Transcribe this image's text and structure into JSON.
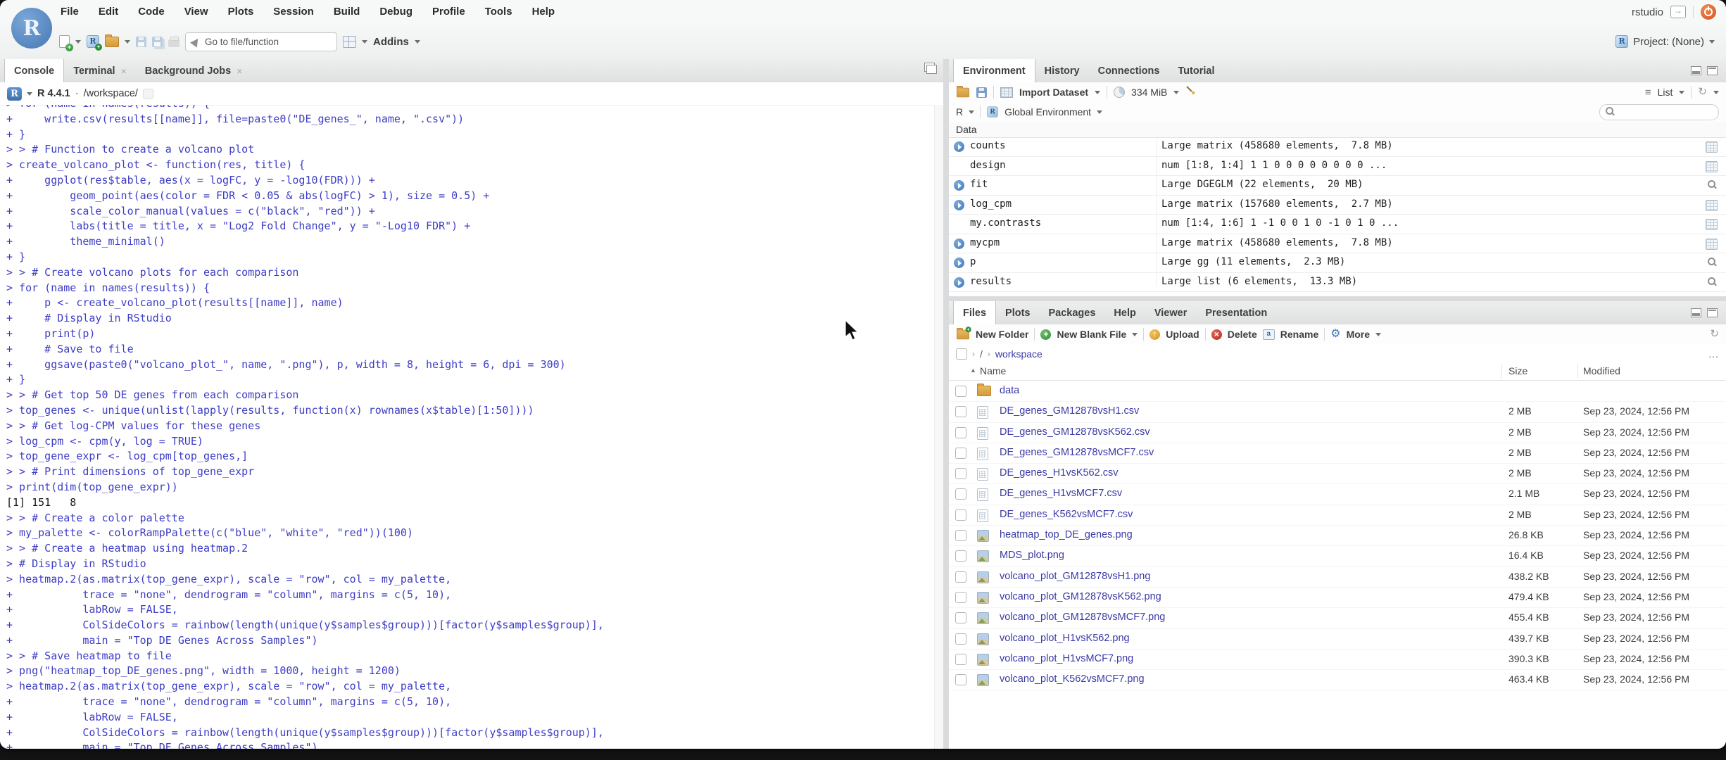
{
  "window": {
    "logo_letter": "R",
    "user": "rstudio",
    "project_label": "Project: (None)"
  },
  "menubar": {
    "items": [
      "File",
      "Edit",
      "Code",
      "View",
      "Plots",
      "Session",
      "Build",
      "Debug",
      "Profile",
      "Tools",
      "Help"
    ]
  },
  "toolbar": {
    "goto_placeholder": "Go to file/function",
    "addins_label": "Addins"
  },
  "console": {
    "tabs": [
      "Console",
      "Terminal",
      "Background Jobs"
    ],
    "r_version": "R 4.4.1",
    "separator": "·",
    "working_dir": "/workspace/",
    "lines": [
      {
        "text": "> for (name in names(results)) {",
        "kind": "input"
      },
      {
        "text": "+     write.csv(results[[name]], file=paste0(\"DE_genes_\", name, \".csv\"))",
        "kind": "input"
      },
      {
        "text": "+ }",
        "kind": "input"
      },
      {
        "text": "> > # Function to create a volcano plot",
        "kind": "input"
      },
      {
        "text": "> create_volcano_plot <- function(res, title) {",
        "kind": "input"
      },
      {
        "text": "+     ggplot(res$table, aes(x = logFC, y = -log10(FDR))) +",
        "kind": "input"
      },
      {
        "text": "+         geom_point(aes(color = FDR < 0.05 & abs(logFC) > 1), size = 0.5) +",
        "kind": "input"
      },
      {
        "text": "+         scale_color_manual(values = c(\"black\", \"red\")) +",
        "kind": "input"
      },
      {
        "text": "+         labs(title = title, x = \"Log2 Fold Change\", y = \"-Log10 FDR\") +",
        "kind": "input"
      },
      {
        "text": "+         theme_minimal()",
        "kind": "input"
      },
      {
        "text": "+ }",
        "kind": "input"
      },
      {
        "text": "> > # Create volcano plots for each comparison",
        "kind": "input"
      },
      {
        "text": "> for (name in names(results)) {",
        "kind": "input"
      },
      {
        "text": "+     p <- create_volcano_plot(results[[name]], name)",
        "kind": "input"
      },
      {
        "text": "+     # Display in RStudio",
        "kind": "input"
      },
      {
        "text": "+     print(p)",
        "kind": "input"
      },
      {
        "text": "+     # Save to file",
        "kind": "input"
      },
      {
        "text": "+     ggsave(paste0(\"volcano_plot_\", name, \".png\"), p, width = 8, height = 6, dpi = 300)",
        "kind": "input"
      },
      {
        "text": "+ }",
        "kind": "input"
      },
      {
        "text": "> > # Get top 50 DE genes from each comparison",
        "kind": "input"
      },
      {
        "text": "> top_genes <- unique(unlist(lapply(results, function(x) rownames(x$table)[1:50])))",
        "kind": "input"
      },
      {
        "text": "> > # Get log-CPM values for these genes",
        "kind": "input"
      },
      {
        "text": "> log_cpm <- cpm(y, log = TRUE)",
        "kind": "input"
      },
      {
        "text": "> top_gene_expr <- log_cpm[top_genes,]",
        "kind": "input"
      },
      {
        "text": "> > # Print dimensions of top_gene_expr",
        "kind": "input"
      },
      {
        "text": "> print(dim(top_gene_expr))",
        "kind": "input"
      },
      {
        "text": "[1] 151   8",
        "kind": "output"
      },
      {
        "text": "> > # Create a color palette",
        "kind": "input"
      },
      {
        "text": "> my_palette <- colorRampPalette(c(\"blue\", \"white\", \"red\"))(100)",
        "kind": "input"
      },
      {
        "text": "> > # Create a heatmap using heatmap.2",
        "kind": "input"
      },
      {
        "text": "> # Display in RStudio",
        "kind": "input"
      },
      {
        "text": "> heatmap.2(as.matrix(top_gene_expr), scale = \"row\", col = my_palette,",
        "kind": "input"
      },
      {
        "text": "+           trace = \"none\", dendrogram = \"column\", margins = c(5, 10),",
        "kind": "input"
      },
      {
        "text": "+           labRow = FALSE,",
        "kind": "input"
      },
      {
        "text": "+           ColSideColors = rainbow(length(unique(y$samples$group)))[factor(y$samples$group)],",
        "kind": "input"
      },
      {
        "text": "+           main = \"Top DE Genes Across Samples\")",
        "kind": "input"
      },
      {
        "text": "> > # Save heatmap to file",
        "kind": "input"
      },
      {
        "text": "> png(\"heatmap_top_DE_genes.png\", width = 1000, height = 1200)",
        "kind": "input"
      },
      {
        "text": "> heatmap.2(as.matrix(top_gene_expr), scale = \"row\", col = my_palette,",
        "kind": "input"
      },
      {
        "text": "+           trace = \"none\", dendrogram = \"column\", margins = c(5, 10),",
        "kind": "input"
      },
      {
        "text": "+           labRow = FALSE,",
        "kind": "input"
      },
      {
        "text": "+           ColSideColors = rainbow(length(unique(y$samples$group)))[factor(y$samples$group)],",
        "kind": "input"
      },
      {
        "text": "+           main = \"Top DE Genes Across Samples\")",
        "kind": "input"
      }
    ]
  },
  "environment": {
    "tabs": [
      "Environment",
      "History",
      "Connections",
      "Tutorial"
    ],
    "toolbar": {
      "import_label": "Import Dataset",
      "memory_label": "334 MiB",
      "list_label": "List"
    },
    "scope_bar": {
      "language": "R",
      "scope_label": "Global Environment"
    },
    "section_header": "Data",
    "entries": [
      {
        "name": "counts",
        "value": "Large matrix (458680 elements,  7.8 MB)",
        "expandable": true,
        "action": "grid"
      },
      {
        "name": "design",
        "value": "num [1:8, 1:4] 1 1 0 0 0 0 0 0 0 0 ...",
        "expandable": false,
        "action": "grid"
      },
      {
        "name": "fit",
        "value": "Large DGEGLM (22 elements,  20 MB)",
        "expandable": true,
        "action": "magnifier"
      },
      {
        "name": "log_cpm",
        "value": "Large matrix (157680 elements,  2.7 MB)",
        "expandable": true,
        "action": "grid"
      },
      {
        "name": "my.contrasts",
        "value": "num [1:4, 1:6] 1 -1 0 0 1 0 -1 0 1 0 ...",
        "expandable": false,
        "action": "grid"
      },
      {
        "name": "mycpm",
        "value": "Large matrix (458680 elements,  7.8 MB)",
        "expandable": true,
        "action": "grid"
      },
      {
        "name": "p",
        "value": "Large gg (11 elements,  2.3 MB)",
        "expandable": true,
        "action": "magnifier"
      },
      {
        "name": "results",
        "value": "Large list (6 elements,  13.3 MB)",
        "expandable": true,
        "action": "magnifier"
      }
    ]
  },
  "files": {
    "tabs": [
      "Files",
      "Plots",
      "Packages",
      "Help",
      "Viewer",
      "Presentation"
    ],
    "toolbar": {
      "new_folder": "New Folder",
      "new_blank_file": "New Blank File",
      "upload": "Upload",
      "delete": "Delete",
      "rename": "Rename",
      "more": "More"
    },
    "breadcrumb": {
      "root": "/",
      "folder": "workspace",
      "ellipsis": "..."
    },
    "columns": {
      "name": "Name",
      "size": "Size",
      "modified": "Modified"
    },
    "rows": [
      {
        "name": "data",
        "type": "folder",
        "size": "",
        "modified": ""
      },
      {
        "name": "DE_genes_GM12878vsH1.csv",
        "type": "csv",
        "size": "2 MB",
        "modified": "Sep 23, 2024, 12:56 PM"
      },
      {
        "name": "DE_genes_GM12878vsK562.csv",
        "type": "csv",
        "size": "2 MB",
        "modified": "Sep 23, 2024, 12:56 PM"
      },
      {
        "name": "DE_genes_GM12878vsMCF7.csv",
        "type": "csv",
        "size": "2 MB",
        "modified": "Sep 23, 2024, 12:56 PM"
      },
      {
        "name": "DE_genes_H1vsK562.csv",
        "type": "csv",
        "size": "2 MB",
        "modified": "Sep 23, 2024, 12:56 PM"
      },
      {
        "name": "DE_genes_H1vsMCF7.csv",
        "type": "csv",
        "size": "2.1 MB",
        "modified": "Sep 23, 2024, 12:56 PM"
      },
      {
        "name": "DE_genes_K562vsMCF7.csv",
        "type": "csv",
        "size": "2 MB",
        "modified": "Sep 23, 2024, 12:56 PM"
      },
      {
        "name": "heatmap_top_DE_genes.png",
        "type": "png",
        "size": "26.8 KB",
        "modified": "Sep 23, 2024, 12:56 PM"
      },
      {
        "name": "MDS_plot.png",
        "type": "png",
        "size": "16.4 KB",
        "modified": "Sep 23, 2024, 12:56 PM"
      },
      {
        "name": "volcano_plot_GM12878vsH1.png",
        "type": "png",
        "size": "438.2 KB",
        "modified": "Sep 23, 2024, 12:56 PM"
      },
      {
        "name": "volcano_plot_GM12878vsK562.png",
        "type": "png",
        "size": "479.4 KB",
        "modified": "Sep 23, 2024, 12:56 PM"
      },
      {
        "name": "volcano_plot_GM12878vsMCF7.png",
        "type": "png",
        "size": "455.4 KB",
        "modified": "Sep 23, 2024, 12:56 PM"
      },
      {
        "name": "volcano_plot_H1vsK562.png",
        "type": "png",
        "size": "439.7 KB",
        "modified": "Sep 23, 2024, 12:56 PM"
      },
      {
        "name": "volcano_plot_H1vsMCF7.png",
        "type": "png",
        "size": "390.3 KB",
        "modified": "Sep 23, 2024, 12:56 PM"
      },
      {
        "name": "volcano_plot_K562vsMCF7.png",
        "type": "png",
        "size": "463.4 KB",
        "modified": "Sep 23, 2024, 12:56 PM"
      }
    ]
  }
}
